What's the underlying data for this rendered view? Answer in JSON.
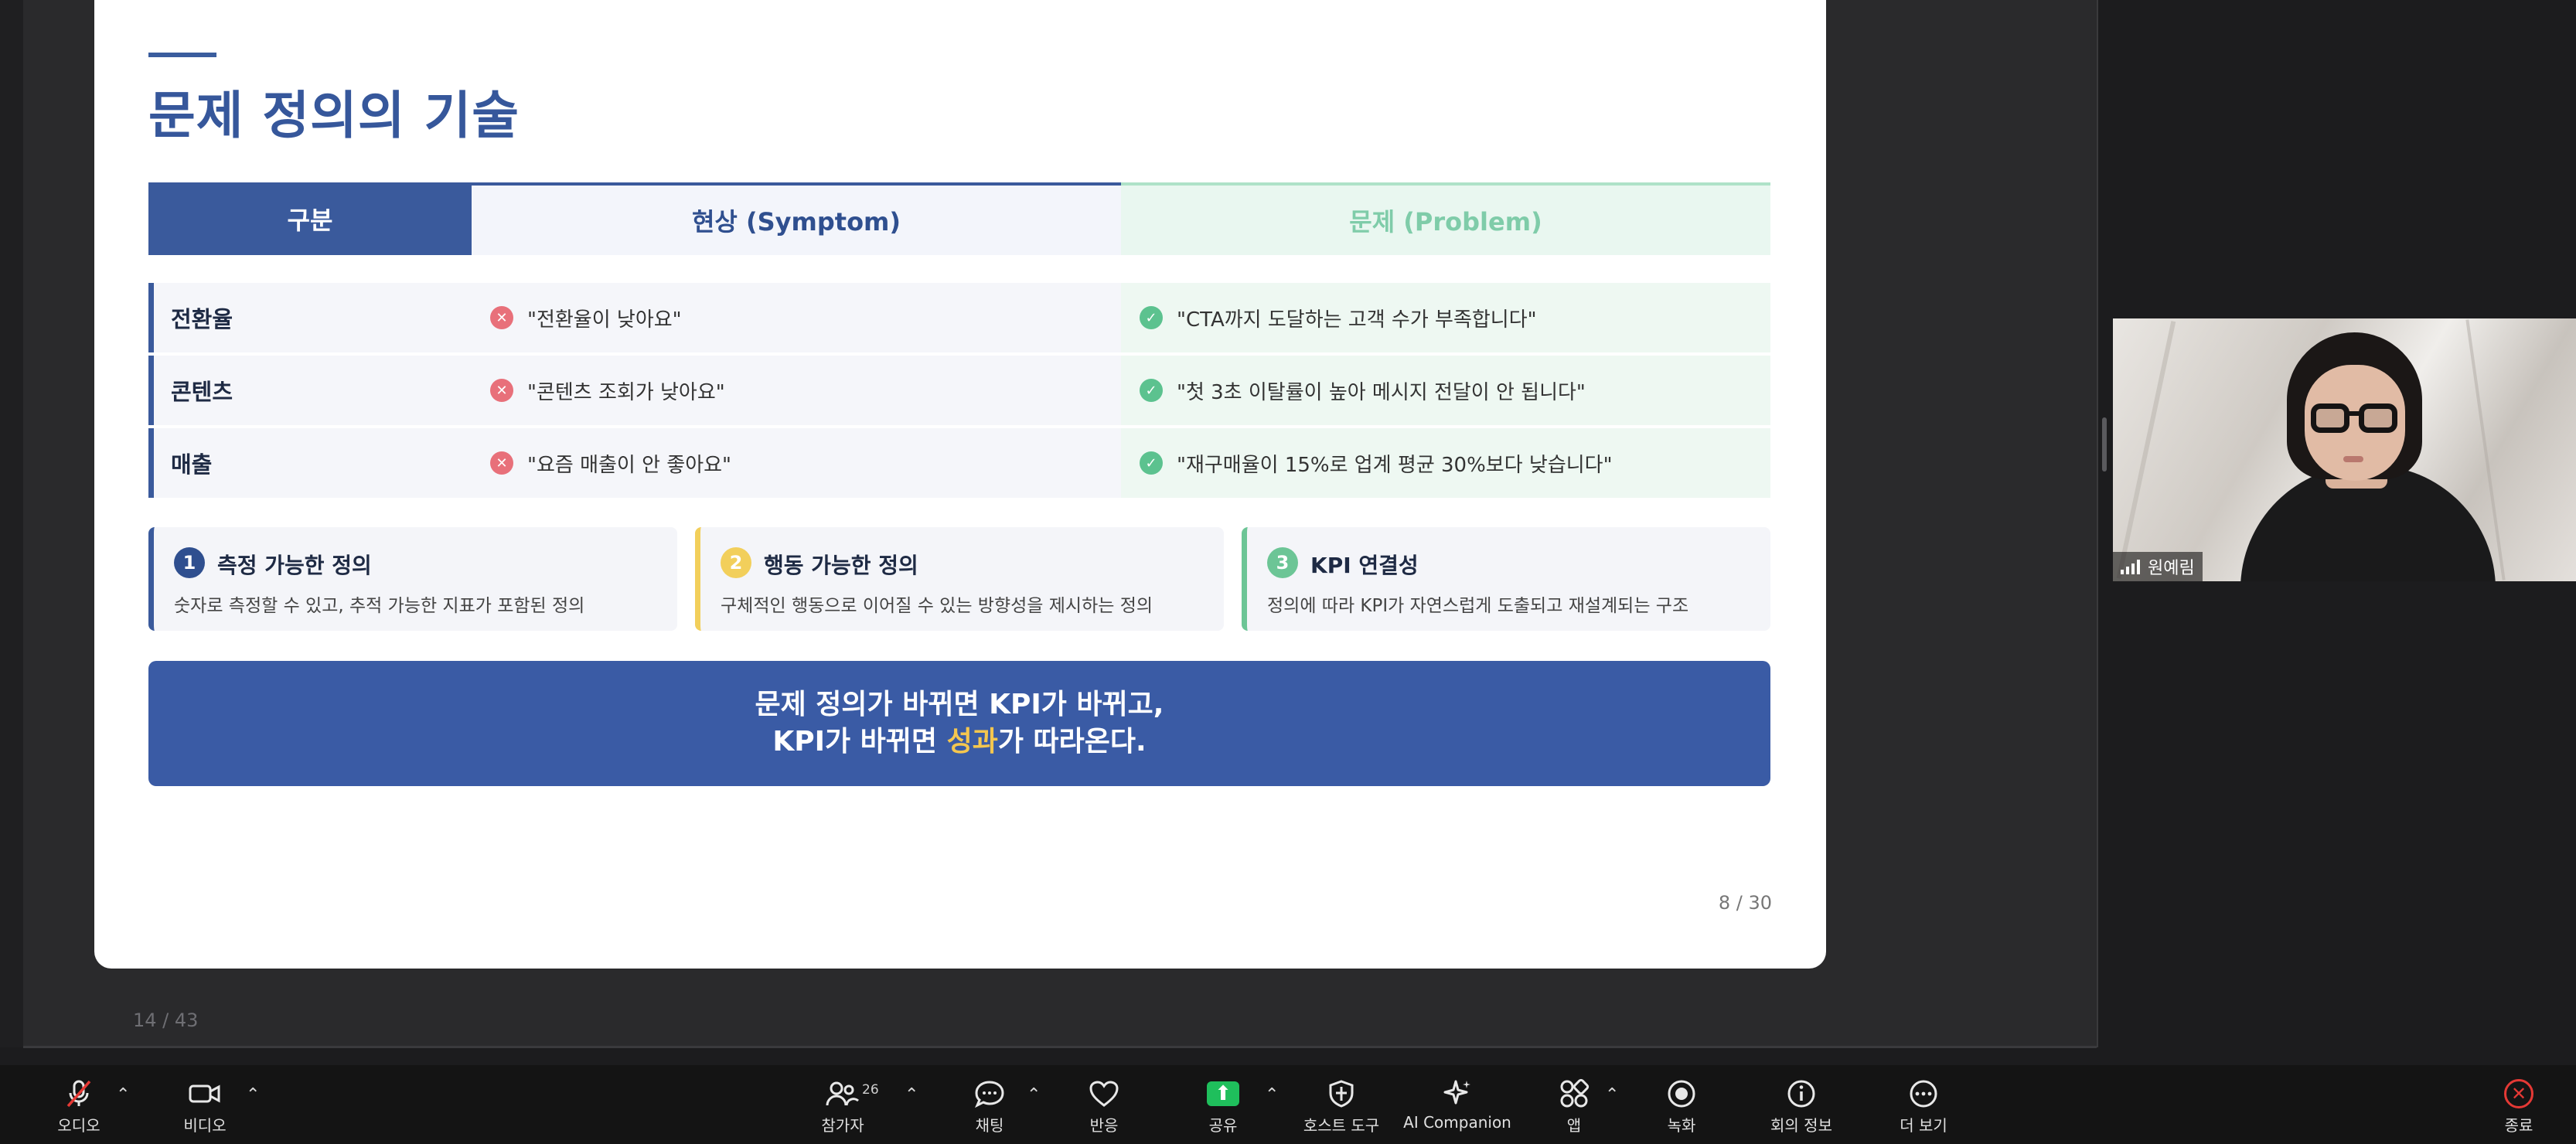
{
  "slide": {
    "title": "문제 정의의 기술",
    "headers": {
      "category": "구분",
      "symptom": "현상 (Symptom)",
      "problem": "문제 (Problem)"
    },
    "rows": [
      {
        "category": "전환율",
        "symptom": "\"전환율이 낮아요\"",
        "problem": "\"CTA까지 도달하는 고객 수가 부족합니다\""
      },
      {
        "category": "콘텐츠",
        "symptom": "\"콘텐츠 조회가 낮아요\"",
        "problem": "\"첫 3초 이탈률이 높아 메시지 전달이 안 됩니다\""
      },
      {
        "category": "매출",
        "symptom": "\"요즘 매출이 안 좋아요\"",
        "problem": "\"재구매율이 15%로 업계 평균 30%보다 낮습니다\""
      }
    ],
    "cards": [
      {
        "num": "1",
        "title": "측정 가능한 정의",
        "desc": "숫자로 측정할 수 있고, 추적 가능한 지표가 포함된 정의",
        "color": "#2f4f8f"
      },
      {
        "num": "2",
        "title": "행동 가능한 정의",
        "desc": "구체적인 행동으로 이어질 수 있는 방향성을 제시하는 정의",
        "color": "#f2cf5b"
      },
      {
        "num": "3",
        "title": "KPI 연결성",
        "desc": "정의에 따라 KPI가 자연스럽게 도출되고 재설계되는 구조",
        "color": "#6cc596"
      }
    ],
    "banner": {
      "line1": "문제 정의가 바뀌면 KPI가 바뀌고,",
      "line2_prefix": "KPI가 바뀌면 ",
      "line2_highlight": "성과",
      "line2_suffix": "가 따라온다."
    },
    "page": "8 / 30"
  },
  "presentation_counter": "14 / 43",
  "participant": {
    "name": "원예림"
  },
  "toolbar": {
    "audio": "오디오",
    "video": "비디오",
    "participants": "참가자",
    "participants_count": "26",
    "chat": "채팅",
    "reactions": "반응",
    "share": "공유",
    "host_tools": "호스트 도구",
    "ai_companion": "AI Companion",
    "apps": "앱",
    "record": "녹화",
    "meeting_info": "회의 정보",
    "more": "더 보기",
    "end": "종료"
  },
  "colors": {
    "accent": "#3a5a9c",
    "share_green": "#1fbf5c",
    "end_red": "#e53935",
    "highlight": "#f4c64f"
  }
}
